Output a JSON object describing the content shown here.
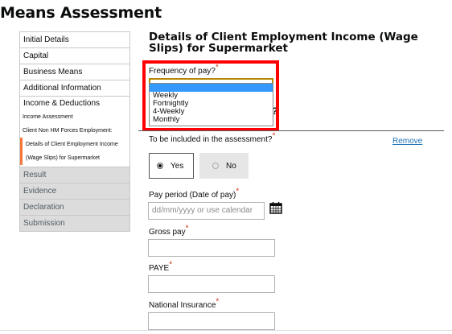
{
  "page": {
    "title": "Means Assessment"
  },
  "sidebar": {
    "items": [
      {
        "label": "Initial Details"
      },
      {
        "label": "Capital"
      },
      {
        "label": "Business Means"
      },
      {
        "label": "Additional Information"
      }
    ],
    "group": {
      "label": "Income & Deductions",
      "subitems": [
        {
          "label": "Income Assessment"
        },
        {
          "label": "Client Non HM Forces Employment:"
        },
        {
          "label": "Details of Client Employment Income"
        },
        {
          "label": "(Wage Slips) for Supermarket"
        }
      ]
    },
    "grey_items": [
      {
        "label": "Result"
      },
      {
        "label": "Evidence"
      },
      {
        "label": "Declaration"
      },
      {
        "label": "Submission"
      }
    ]
  },
  "section": {
    "title": "Details of Client Employment Income (Wage Slips) for Supermarket"
  },
  "frequency": {
    "label": "Frequency of pay?",
    "required": "*",
    "options": [
      "",
      "Weekly",
      "Fortnightly",
      "4-Weekly",
      "Monthly"
    ],
    "partial_hidden_text": "?"
  },
  "included": {
    "label": "To be included in the assessment?",
    "required": "*",
    "remove_link": "Remove"
  },
  "radio": {
    "yes": "Yes",
    "no": "No",
    "selected": "Yes"
  },
  "pay_period": {
    "label": "Pay period (Date of pay)",
    "required": "*",
    "placeholder": "dd/mm/yyyy or use calendar"
  },
  "gross_pay": {
    "label": "Gross pay",
    "required": "*"
  },
  "paye": {
    "label": "PAYE",
    "required": "*"
  },
  "ni": {
    "label": "National Insurance",
    "required": "*"
  },
  "colors": {
    "accent_red": "#ff0000",
    "link_blue": "#1d70b8",
    "required_red": "#d4351c",
    "active_orange": "#f47738"
  }
}
